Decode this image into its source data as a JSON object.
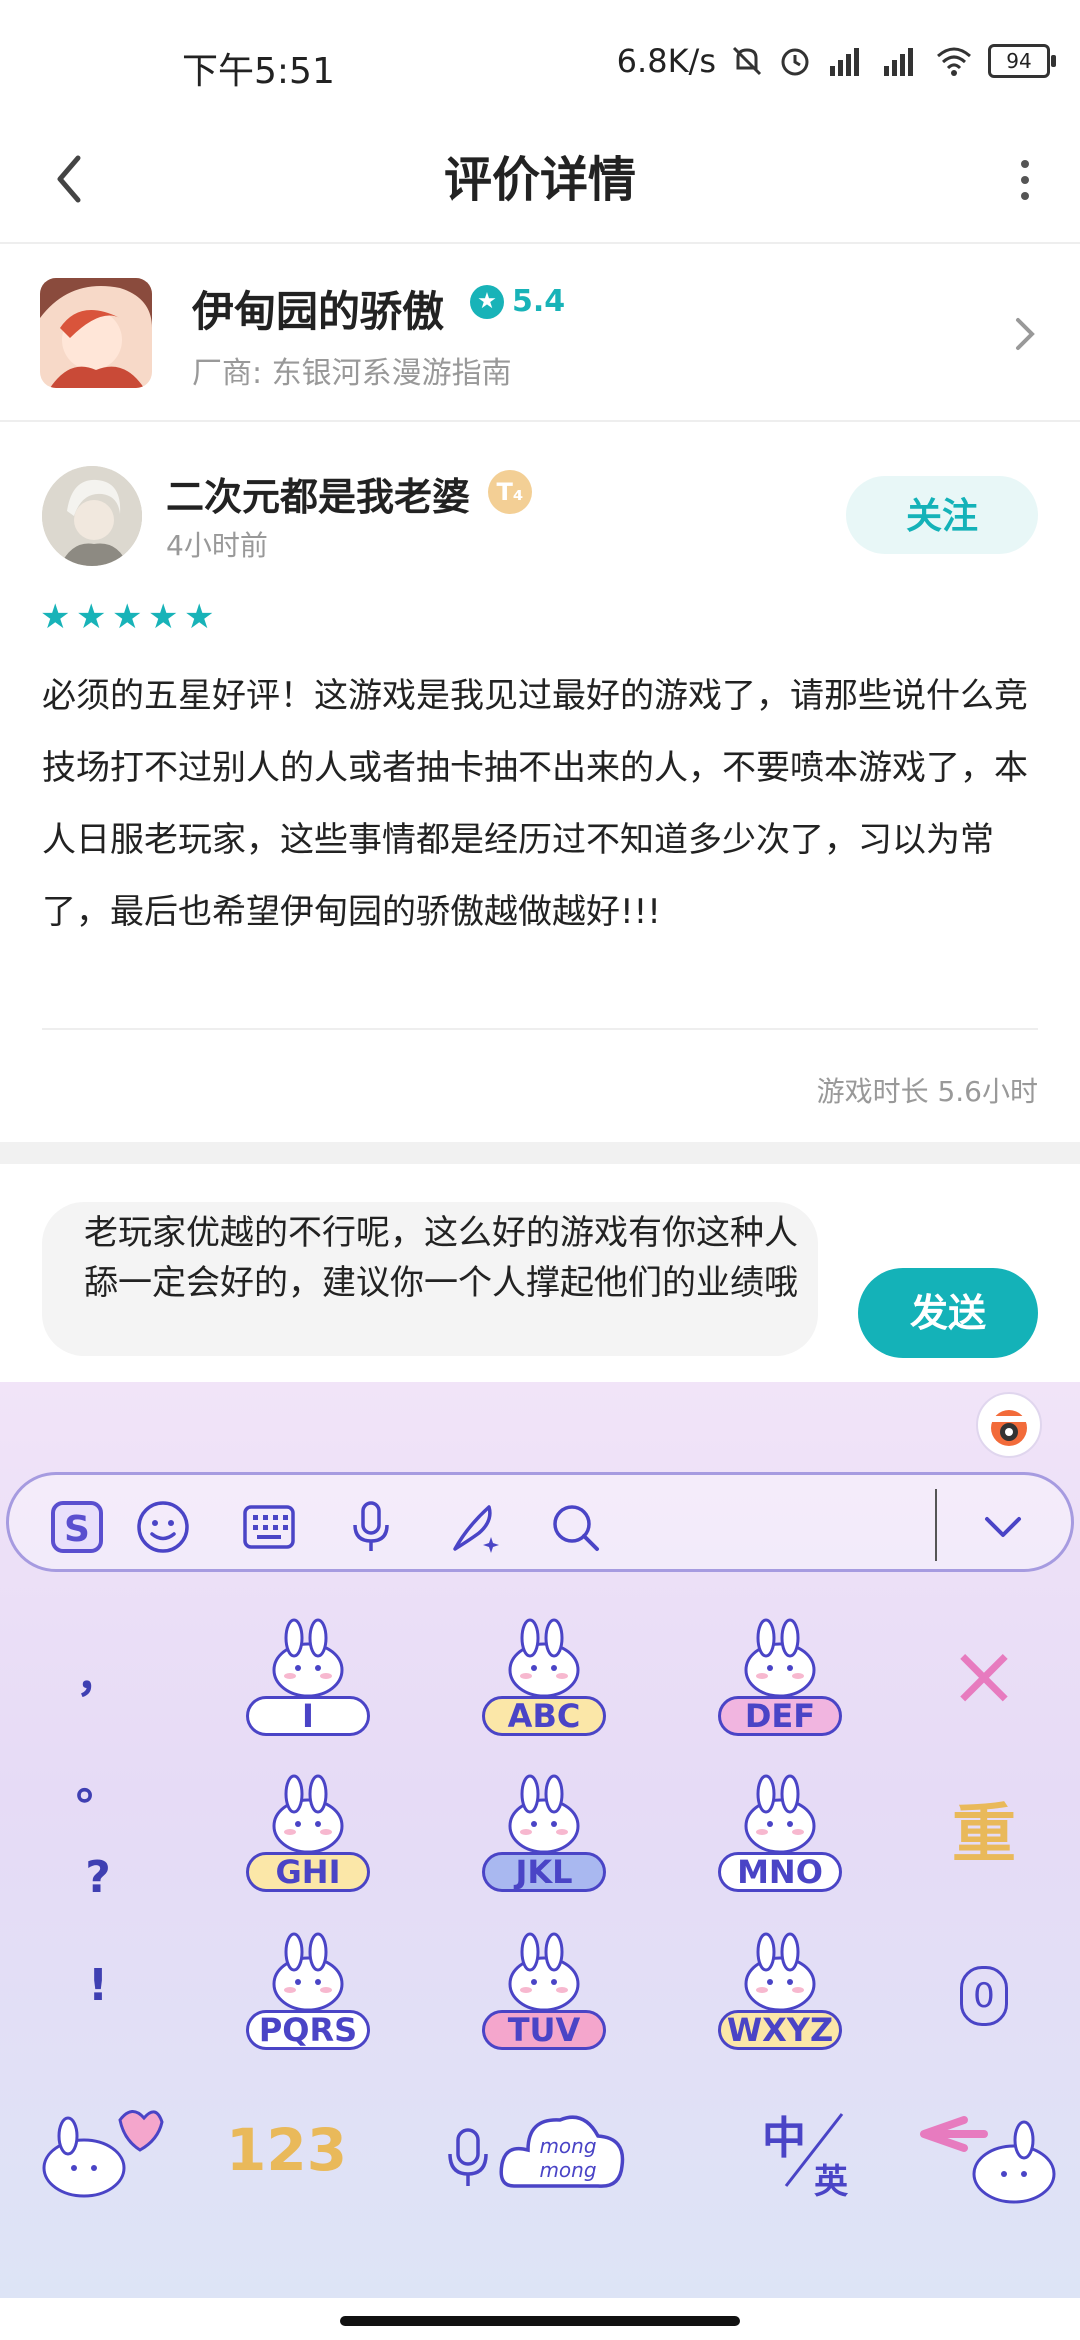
{
  "status_bar": {
    "time": "下午5:51",
    "speed": "6.8K/s",
    "battery": "94"
  },
  "header": {
    "title": "评价详情"
  },
  "game": {
    "name": "伊甸园的骄傲",
    "score": "5.4",
    "vendor": "厂商: 东银河系漫游指南"
  },
  "review": {
    "username": "二次元都是我老婆",
    "badge": "T₄",
    "posted": "4小时前",
    "follow_label": "关注",
    "stars": 5,
    "text": "必须的五星好评！这游戏是我见过最好的游戏了，请那些说什么竞技场打不过别人的人或者抽卡抽不出来的人，不要喷本游戏了，本人日服老玩家，这些事情都是经历过不知道多少次了，习以为常了，最后也希望伊甸园的骄傲越做越好!!!",
    "playtime": "游戏时长 5.6小时"
  },
  "reply": {
    "text": "老玩家优越的不行呢，这么好的游戏有你这种人舔一定会好的，建议你一个人撑起他们的业绩哦",
    "send_label": "发送"
  },
  "keyboard": {
    "toolbar_icons": [
      "sogou-logo-icon",
      "emoji-icon",
      "keyboard-icon",
      "microphone-icon",
      "handwriting-icon",
      "search-icon",
      "collapse-icon"
    ],
    "punctuation": [
      "，",
      "。",
      "?",
      "!"
    ],
    "keys": [
      {
        "label": "I",
        "pill_color": "#ffffff"
      },
      {
        "label": "ABC",
        "pill_color": "#fbe7a8"
      },
      {
        "label": "DEF",
        "pill_color": "#f1b5e0"
      },
      {
        "label": "GHI",
        "pill_color": "#fbe7a8"
      },
      {
        "label": "JKL",
        "pill_color": "#a9b8f0"
      },
      {
        "label": "MNO",
        "pill_color": "#ffffff"
      },
      {
        "label": "PQRS",
        "pill_color": "#ffffff"
      },
      {
        "label": "TUV",
        "pill_color": "#f4a6cc"
      },
      {
        "label": "WXYZ",
        "pill_color": "#fbe7a8"
      }
    ],
    "side_keys": {
      "delete": "×",
      "reenter": "重",
      "zero": "0"
    },
    "bottom": {
      "numbers": "123",
      "voice_text": "mong mong",
      "lang_cn": "中",
      "lang_en": "英"
    }
  }
}
